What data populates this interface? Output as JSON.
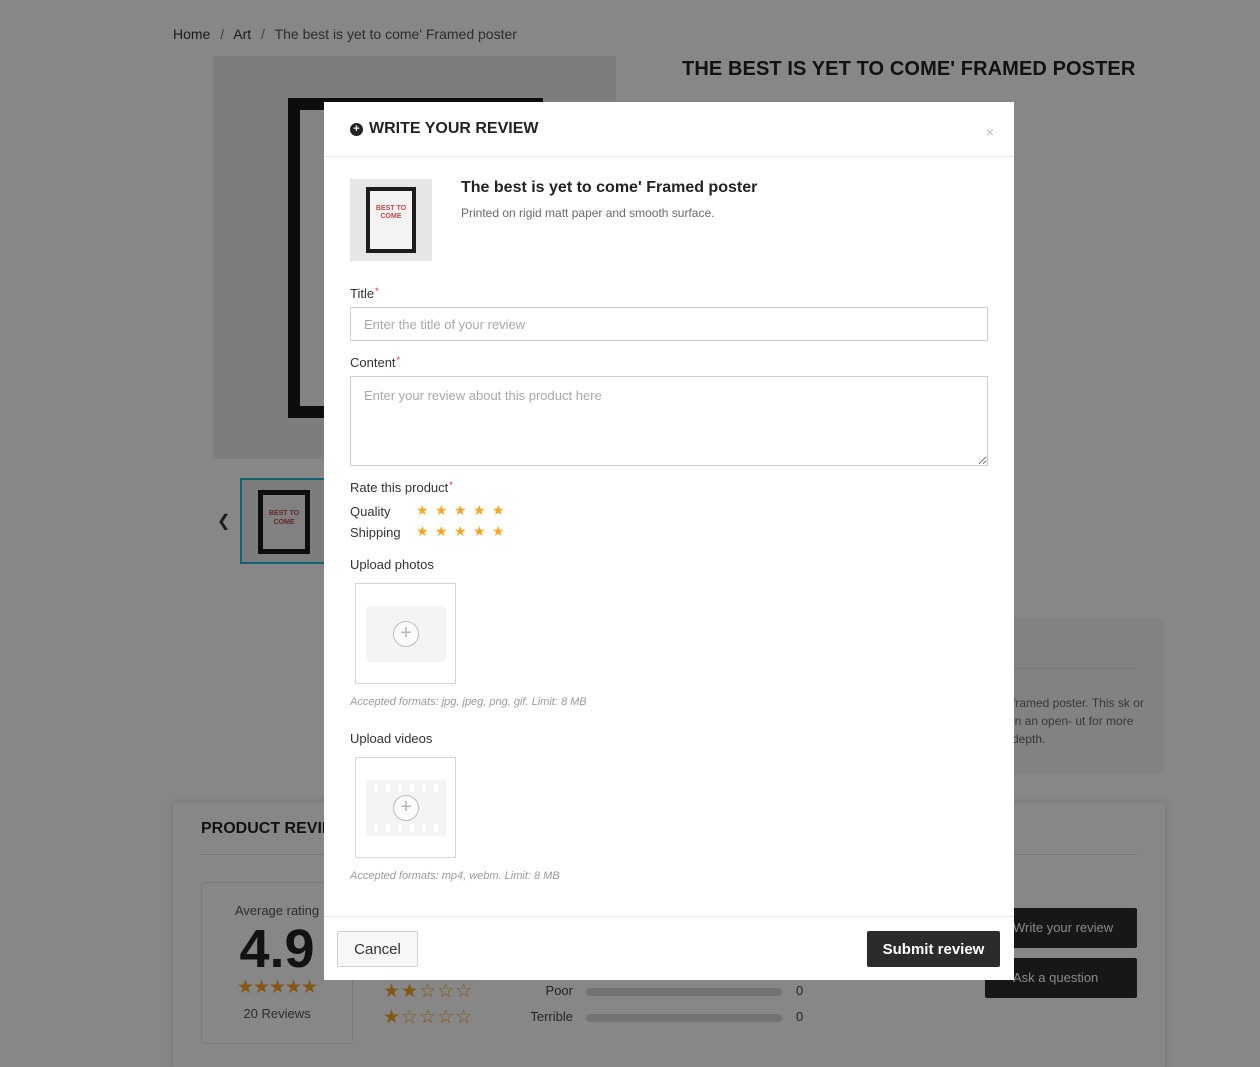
{
  "breadcrumb": {
    "home": "Home",
    "separator": "/",
    "category": "Art",
    "current": "The best is yet to come' Framed poster"
  },
  "product": {
    "title": "THE BEST IS YET TO COME' FRAMED POSTER",
    "poster_text": "BEST TO COME"
  },
  "description_snippet": "framed poster. This sk or in an open- ut for more depth.",
  "reviews": {
    "section_title": "PRODUCT REVIEWS",
    "average_label": "Average rating",
    "average_value": "4.9",
    "average_stars": "★★★★★",
    "count_label": "20 Reviews",
    "distribution": [
      {
        "stars": "★★☆☆☆",
        "label": "Poor",
        "count": "0",
        "fraction": 0
      },
      {
        "stars": "★☆☆☆☆",
        "label": "Terrible",
        "count": "0",
        "fraction": 0
      }
    ],
    "write_button": "Write your review",
    "ask_button": "Ask a question"
  },
  "modal": {
    "title": "WRITE YOUR REVIEW",
    "close_icon": "×",
    "product_name": "The best is yet to come' Framed poster",
    "product_desc": "Printed on rigid matt paper and smooth surface.",
    "required_mark": "*",
    "title_label": "Title",
    "title_placeholder": "Enter the title of your review",
    "title_value": "",
    "content_label": "Content",
    "content_placeholder": "Enter your review about this product here",
    "content_value": "",
    "rate_label": "Rate this product",
    "ratings": [
      {
        "name": "Quality",
        "value": 5,
        "max": 5
      },
      {
        "name": "Shipping",
        "value": 5,
        "max": 5
      }
    ],
    "upload_photos_label": "Upload photos",
    "upload_photos_hint": "Accepted formats: jpg, jpeg, png, gif. Limit: 8 MB",
    "upload_videos_label": "Upload videos",
    "upload_videos_hint": "Accepted formats: mp4, webm. Limit: 8 MB",
    "cancel_label": "Cancel",
    "submit_label": "Submit review"
  },
  "colors": {
    "accent": "#24b9d7",
    "star": "#f5a623",
    "button_dark": "#2b2b2b",
    "required": "#e0242f"
  },
  "icons": {
    "title_icon": "plus-circle-icon",
    "close": "close-icon",
    "upload_photo": "add-photo-icon",
    "upload_video": "add-video-icon",
    "thumb_prev": "chevron-left-icon"
  }
}
